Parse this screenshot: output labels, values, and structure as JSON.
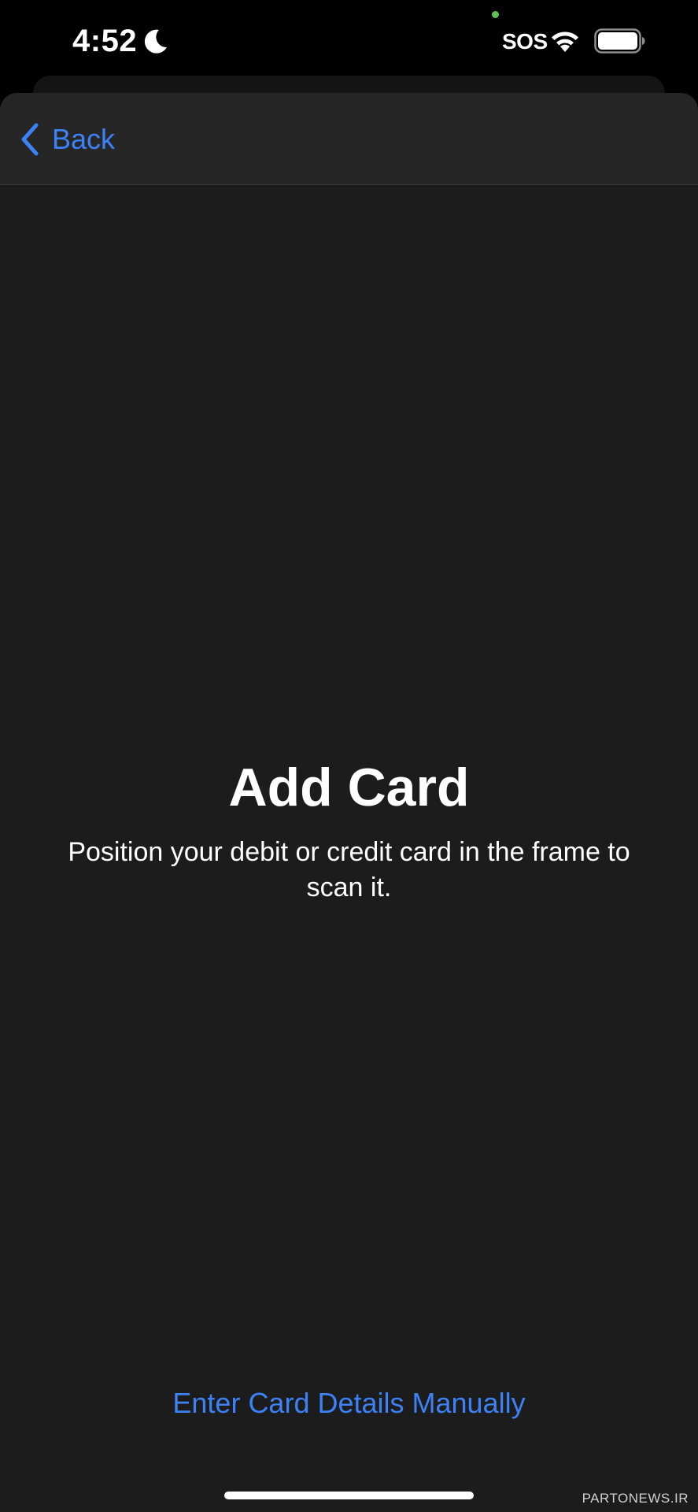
{
  "status_bar": {
    "time": "4:52",
    "carrier_status": "SOS",
    "icons": [
      "moon-icon",
      "wifi-icon",
      "battery-icon"
    ]
  },
  "nav": {
    "back_label": "Back",
    "back_icon": "chevron-left-icon"
  },
  "main": {
    "title": "Add Card",
    "subtitle": "Position your debit or credit card in the frame to scan it.",
    "manual_entry_label": "Enter Card Details Manually"
  },
  "watermark": "PARTONEWS.IR",
  "colors": {
    "accent": "#3c82f6",
    "background": "#1c1c1d",
    "nav_background": "#262627",
    "text": "#ffffff",
    "camera_indicator": "#5fc152"
  }
}
